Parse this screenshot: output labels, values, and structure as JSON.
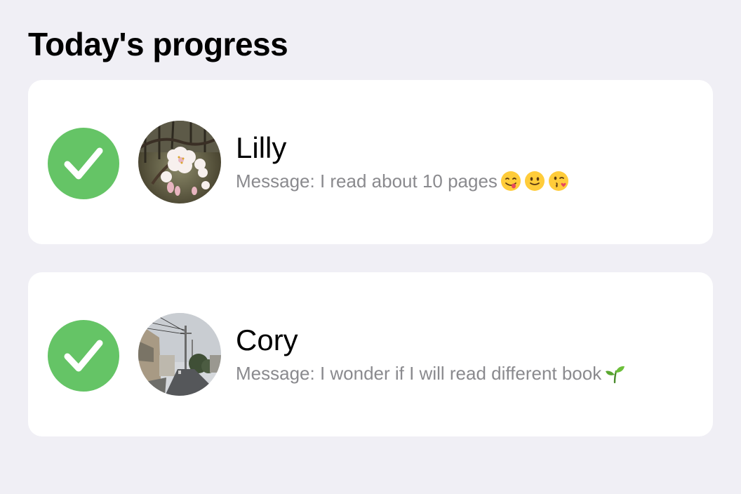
{
  "header": {
    "title": "Today's progress"
  },
  "colors": {
    "background": "#f0eff5",
    "card": "#ffffff",
    "check_green": "#65c466",
    "message_gray": "#8a8a8e"
  },
  "entries": [
    {
      "name": "Lilly",
      "message": "Message: I read about 10 pages",
      "status_icon": "checkmark-circle-icon",
      "avatar": "cherry-blossom-photo",
      "emojis": [
        "face-savoring-food-emoji",
        "slightly-smiling-face-emoji",
        "face-blowing-kiss-emoji"
      ]
    },
    {
      "name": "Cory",
      "message": "Message: I wonder if I will read different book",
      "status_icon": "checkmark-circle-icon",
      "avatar": "street-photo",
      "emojis": [
        "seedling-emoji"
      ]
    }
  ]
}
